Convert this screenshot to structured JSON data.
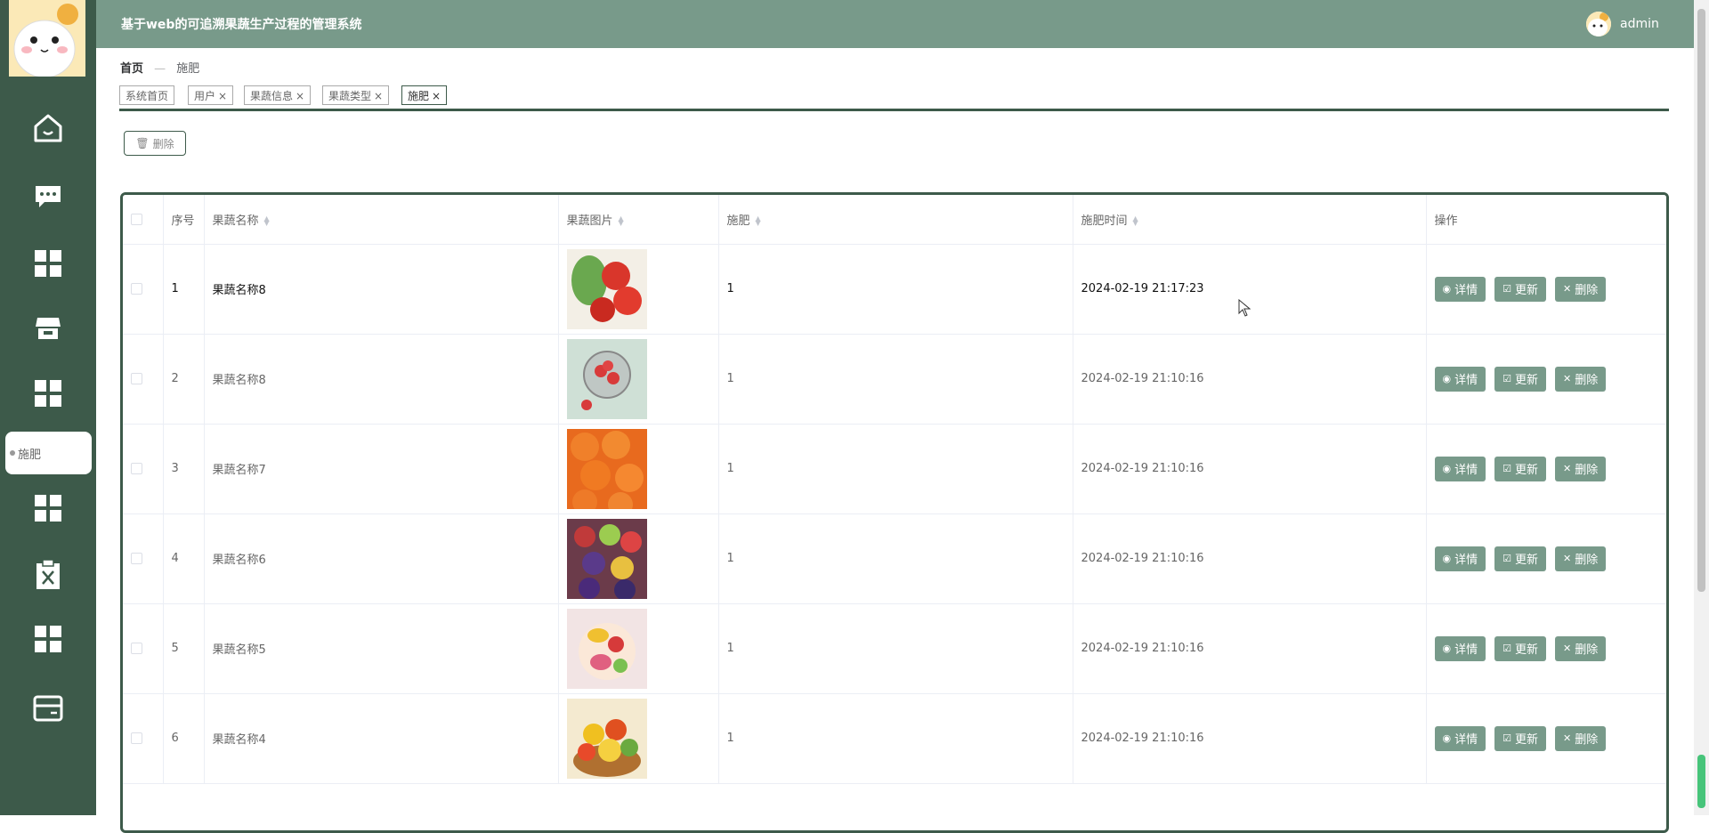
{
  "header": {
    "title": "基于web的可追溯果蔬生产过程的管理系统",
    "username": "admin"
  },
  "breadcrumb": {
    "home": "首页",
    "sep": "—",
    "current": "施肥"
  },
  "tags": [
    {
      "label": "系统首页"
    },
    {
      "label": "用户"
    },
    {
      "label": "果蔬信息"
    },
    {
      "label": "果蔬类型"
    },
    {
      "label": "施肥"
    }
  ],
  "sidebar": {
    "icons": [
      "home-icon",
      "chat-icon",
      "grid-icon",
      "store-icon",
      "grid-icon",
      "grid-icon",
      "clipboard-x-icon",
      "grid-icon",
      "card-icon"
    ],
    "active_label": "施肥"
  },
  "toolbar": {
    "delete_label": "删除"
  },
  "table": {
    "headers": {
      "index": "序号",
      "name": "果蔬名称",
      "image": "果蔬图片",
      "fert": "施肥",
      "time": "施肥时间",
      "ops": "操作"
    },
    "rows": [
      {
        "index": "1",
        "name": "果蔬名称8",
        "fert": "1",
        "time": "2024-02-19 21:17:23"
      },
      {
        "index": "2",
        "name": "果蔬名称8",
        "fert": "1",
        "time": "2024-02-19 21:10:16"
      },
      {
        "index": "3",
        "name": "果蔬名称7",
        "fert": "1",
        "time": "2024-02-19 21:10:16"
      },
      {
        "index": "4",
        "name": "果蔬名称6",
        "fert": "1",
        "time": "2024-02-19 21:10:16"
      },
      {
        "index": "5",
        "name": "果蔬名称5",
        "fert": "1",
        "time": "2024-02-19 21:10:16"
      },
      {
        "index": "6",
        "name": "果蔬名称4",
        "fert": "1",
        "time": "2024-02-19 21:10:16"
      }
    ],
    "ops": {
      "detail": "详情",
      "update": "更新",
      "delete": "删除"
    }
  },
  "colors": {
    "sidebar": "#3d5a4a",
    "header": "#789a8a",
    "button": "#789a8a"
  }
}
